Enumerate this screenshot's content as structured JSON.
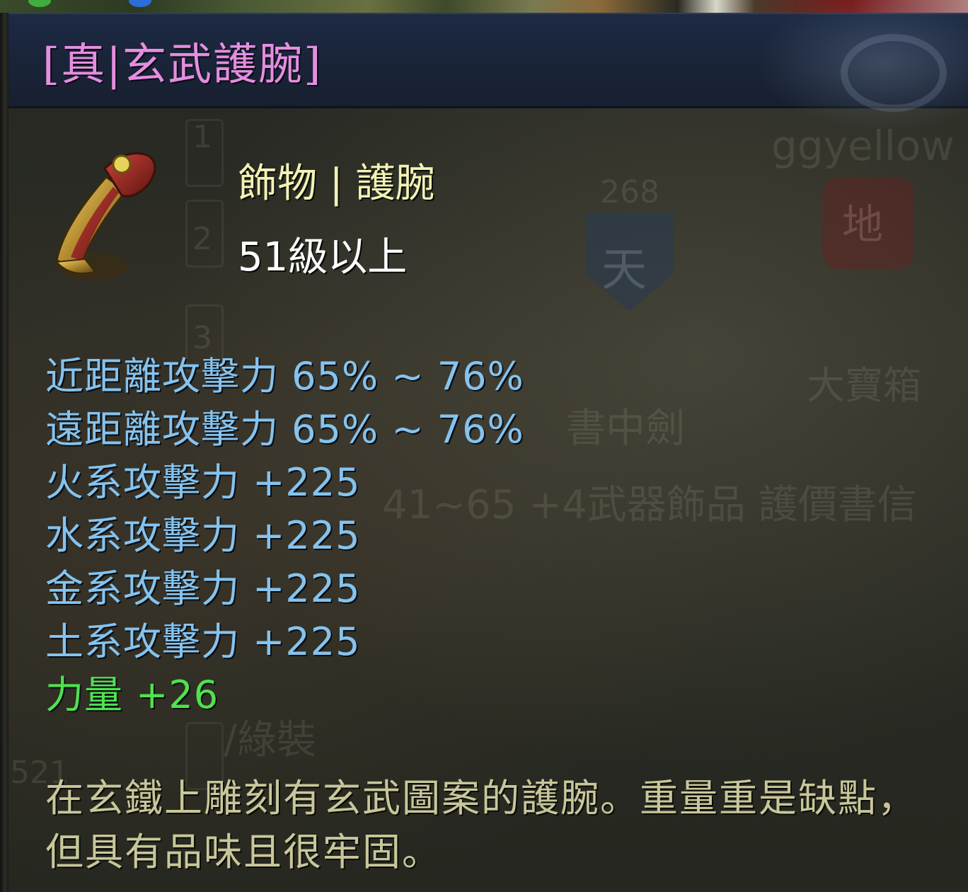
{
  "tooltip": {
    "title": "[真|玄武護腕]",
    "item_type": "飾物 | 護腕",
    "level_requirement": "51級以上",
    "icon": "bracer-item-icon",
    "stats": [
      {
        "text": "近距離攻擊力 65% ~ 76%",
        "color": "#85c3ee"
      },
      {
        "text": "遠距離攻擊力 65% ~ 76%",
        "color": "#85c3ee"
      },
      {
        "text": "火系攻擊力 +225",
        "color": "#85c3ee"
      },
      {
        "text": "水系攻擊力 +225",
        "color": "#85c3ee"
      },
      {
        "text": "金系攻擊力 +225",
        "color": "#85c3ee"
      },
      {
        "text": "土系攻擊力 +225",
        "color": "#85c3ee"
      },
      {
        "text": "力量 +26",
        "color": "#4fe24f"
      }
    ],
    "description_lines": [
      "在玄鐵上雕刻有玄武圖案的護腕。重量重是缺點，",
      "但具有品味且很牢固。"
    ],
    "colors": {
      "title": "#e58ee0",
      "item_type": "#f2f2b4",
      "level": "#ffffff",
      "description": "#c9c79a",
      "title_bar": "#1a2438"
    }
  },
  "background_scene": {
    "texts": [
      "ggyellow",
      "268",
      "大寶箱",
      "書中劍",
      "41~65 +4武器飾品 護價書信",
      "/綠裝",
      "1",
      "2",
      "3",
      "521"
    ],
    "shield_char": "天",
    "badge_char": "地"
  }
}
